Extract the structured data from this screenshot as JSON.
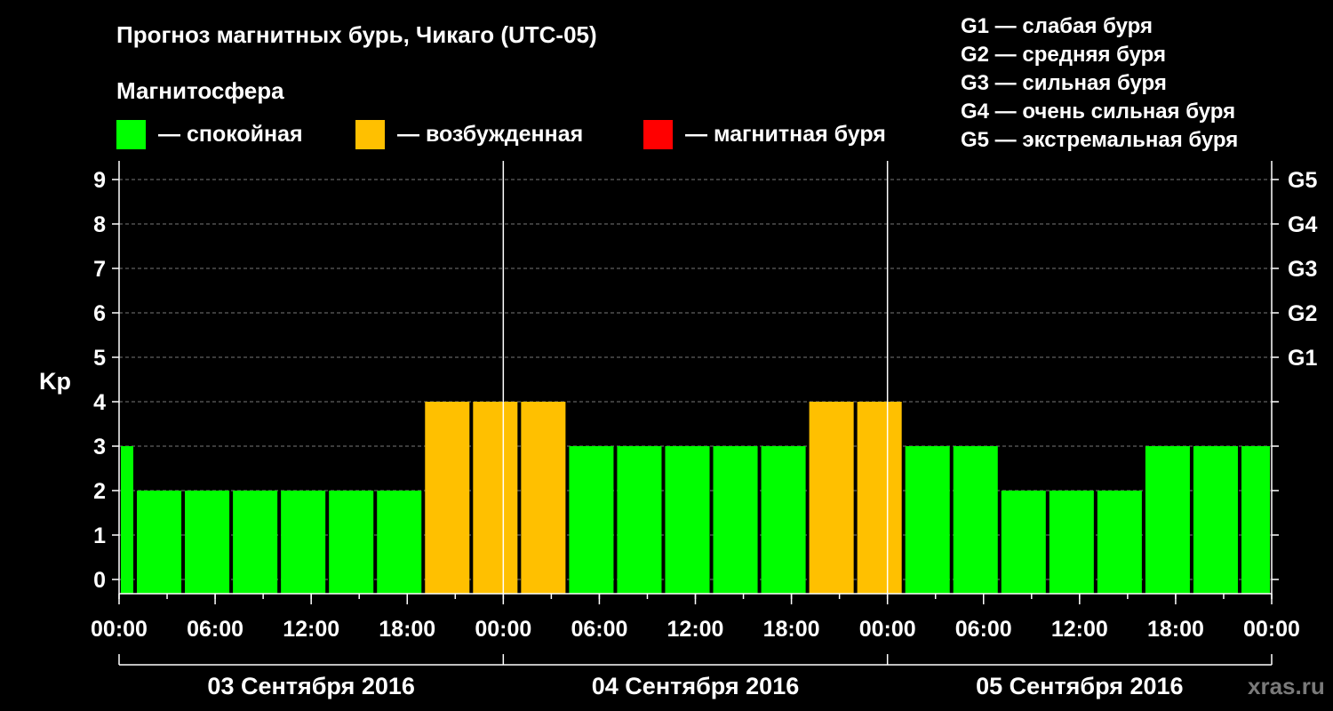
{
  "chart_data": {
    "type": "bar",
    "title": "Прогноз магнитных бурь, Чикаго (UTC-05)",
    "subtitle": "Магнитосфера",
    "ylabel": "Kp",
    "ylim": [
      0,
      9
    ],
    "yticks": [
      "0",
      "1",
      "2",
      "3",
      "4",
      "5",
      "6",
      "7",
      "8",
      "9"
    ],
    "gticks": [
      {
        "kp": 5,
        "label": "G1"
      },
      {
        "kp": 6,
        "label": "G2"
      },
      {
        "kp": 7,
        "label": "G3"
      },
      {
        "kp": 8,
        "label": "G4"
      },
      {
        "kp": 9,
        "label": "G5"
      }
    ],
    "x_tick_labels": [
      "00:00",
      "06:00",
      "12:00",
      "18:00",
      "00:00",
      "06:00",
      "12:00",
      "18:00",
      "00:00",
      "06:00",
      "12:00",
      "18:00",
      "00:00"
    ],
    "days": [
      "03 Сентября 2016",
      "04 Сентября 2016",
      "05 Сентября 2016"
    ],
    "bar_start_hours": [
      0,
      3,
      6,
      9,
      12,
      15,
      18,
      21,
      24,
      27,
      30,
      33,
      36,
      39,
      42,
      45,
      48,
      51,
      54,
      57,
      60,
      63,
      66,
      69
    ],
    "values": [
      3,
      2,
      2,
      2,
      2,
      2,
      2,
      4,
      4,
      4,
      3,
      3,
      3,
      3,
      3,
      4,
      4,
      3,
      3,
      2,
      2,
      2,
      3,
      3,
      3
    ],
    "legend": [
      {
        "label": "— спокойная",
        "color": "#00ff00"
      },
      {
        "label": "— возбужденная",
        "color": "#ffc000"
      },
      {
        "label": "— магнитная буря",
        "color": "#ff0000"
      }
    ],
    "g_legend": [
      "G1 — слабая буря",
      "G2 — средняя буря",
      "G3 — сильная буря",
      "G4 — очень сильная буря",
      "G5 — экстремальная буря"
    ]
  },
  "brand": "xras.ru"
}
